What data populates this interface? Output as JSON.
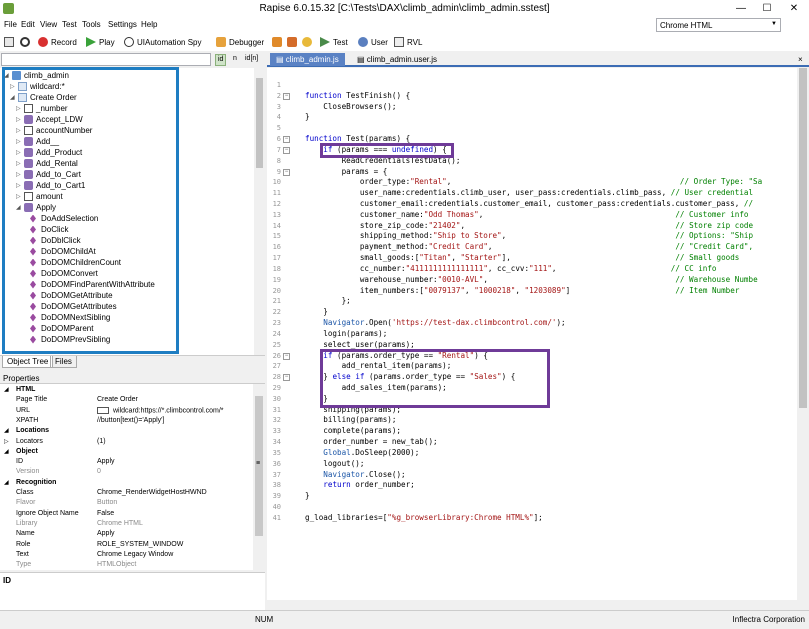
{
  "title": "Rapise 6.0.15.32 [C:\\Tests\\DAX\\climb_admin\\climb_admin.sstest]",
  "window_controls": [
    "—",
    "☐",
    "✕"
  ],
  "menu": [
    "File",
    "Edit",
    "View",
    "Test",
    "Tools",
    "Settings",
    "Help"
  ],
  "browser_select": "Chrome HTML",
  "toolbar": {
    "record": "Record",
    "play": "Play",
    "spy": "UIAutomation Spy",
    "debugger": "Debugger",
    "test": "Test",
    "user": "User",
    "rvl": "RVL"
  },
  "search": {
    "id_label": "id",
    "n_label": "n",
    "idn_label": "id[n]"
  },
  "tree": {
    "root": "climb_admin",
    "wildcard": "wildcard:*",
    "create_order": "Create Order",
    "objects": [
      "_number",
      "Accept_LDW",
      "accountNumber",
      "Add__",
      "Add_Product",
      "Add_Rental",
      "Add_to_Cart",
      "Add_to_Cart1",
      "amount"
    ],
    "apply": "Apply",
    "actions": [
      "DoAddSelection",
      "DoClick",
      "DoDblClick",
      "DoDOMChildAt",
      "DoDOMChildrenCount",
      "DoDOMConvert",
      "DoDOMFindParentWithAttribute",
      "DoDOMGetAttribute",
      "DoDOMGetAttributes",
      "DoDOMNextSibling",
      "DoDOMParent",
      "DoDOMPrevSibling"
    ]
  },
  "left_tabs": [
    "Object Tree",
    "Files"
  ],
  "properties": {
    "header": "Properties",
    "rows": [
      {
        "k": "HTML",
        "v": "",
        "sec": true,
        "exp": "◢"
      },
      {
        "k": "Page Title",
        "v": "Create Order"
      },
      {
        "k": "URL",
        "v": "wildcard:https://*.climbcontrol.com/*"
      },
      {
        "k": "XPATH",
        "v": "//button[text()='Apply']"
      },
      {
        "k": "Locations",
        "v": "",
        "sec": true,
        "exp": "◢"
      },
      {
        "k": "Locators",
        "v": "(1)",
        "exp": "▷"
      },
      {
        "k": "Object",
        "v": "",
        "sec": true,
        "exp": "◢"
      },
      {
        "k": "ID",
        "v": "Apply"
      },
      {
        "k": "Version",
        "v": "0",
        "gray": true
      },
      {
        "k": "Recognition",
        "v": "",
        "sec": true,
        "exp": "◢"
      },
      {
        "k": "Class",
        "v": "Chrome_RenderWidgetHostHWND"
      },
      {
        "k": "Flavor",
        "v": "Button",
        "gray": true
      },
      {
        "k": "Ignore Object Name",
        "v": "False"
      },
      {
        "k": "Library",
        "v": "Chrome HTML",
        "gray": true
      },
      {
        "k": "Name",
        "v": "Apply"
      },
      {
        "k": "Role",
        "v": "ROLE_SYSTEM_WINDOW"
      },
      {
        "k": "Text",
        "v": "Chrome Legacy Window"
      },
      {
        "k": "Type",
        "v": "HTMLObject",
        "gray": true
      }
    ]
  },
  "description": "ID",
  "editor_tabs": [
    "climb_admin.js",
    "climb_admin.user.js"
  ],
  "code": [
    {
      "n": "1",
      "t": ""
    },
    {
      "n": "2",
      "t": "function TestFinish() {",
      "fold": "−"
    },
    {
      "n": "3",
      "t": "    CloseBrowsers();"
    },
    {
      "n": "4",
      "t": "}"
    },
    {
      "n": "5",
      "t": ""
    },
    {
      "n": "6",
      "t": "function Test(params) {",
      "fold": "−"
    },
    {
      "n": "7",
      "t": "    if (params === undefined) {",
      "fold": "−"
    },
    {
      "n": "8",
      "t": "        ReadCredentialsTestData();"
    },
    {
      "n": "9",
      "t": "        params = {",
      "fold": "−"
    },
    {
      "n": "10",
      "t": "            order_type:\"Rental\",                                                  // Order Type: \"Sa"
    },
    {
      "n": "11",
      "t": "            user_name:credentials.climb_user, user_pass:credentials.climb_pass, // User credential"
    },
    {
      "n": "12",
      "t": "            customer_email:credentials.customer_email, customer_pass:credentials.customer_pass, //"
    },
    {
      "n": "13",
      "t": "            customer_name:\"Odd Thomas\",                                          // Customer info"
    },
    {
      "n": "14",
      "t": "            store_zip_code:\"21402\",                                              // Store zip code"
    },
    {
      "n": "15",
      "t": "            shipping_method:\"Ship to Store\",                                     // Options: \"Ship"
    },
    {
      "n": "16",
      "t": "            payment_method:\"Credit Card\",                                        // \"Credit Card\","
    },
    {
      "n": "17",
      "t": "            small_goods:[\"Titan\", \"Starter\"],                                    // Small goods"
    },
    {
      "n": "18",
      "t": "            cc_number:\"4111111111111111\", cc_cvv:\"111\",                         // CC info"
    },
    {
      "n": "19",
      "t": "            warehouse_number:\"0010-AVL\",                                         // Warehouse Numbe"
    },
    {
      "n": "20",
      "t": "            item_numbers:[\"0079137\", \"1000218\", \"1203089\"]                       // Item Number"
    },
    {
      "n": "21",
      "t": "        };"
    },
    {
      "n": "22",
      "t": "    }"
    },
    {
      "n": "23",
      "t": "    Navigator.Open('https://test-dax.climbcontrol.com/');"
    },
    {
      "n": "24",
      "t": "    login(params);"
    },
    {
      "n": "25",
      "t": "    select_user(params);"
    },
    {
      "n": "26",
      "t": "    if (params.order_type == \"Rental\") {",
      "fold": "−"
    },
    {
      "n": "27",
      "t": "        add_rental_item(params);"
    },
    {
      "n": "28",
      "t": "    } else if (params.order_type == \"Sales\") {",
      "fold": "−"
    },
    {
      "n": "29",
      "t": "        add_sales_item(params);"
    },
    {
      "n": "30",
      "t": "    }"
    },
    {
      "n": "31",
      "t": "    shipping(params);"
    },
    {
      "n": "32",
      "t": "    billing(params);"
    },
    {
      "n": "33",
      "t": "    complete(params);"
    },
    {
      "n": "34",
      "t": "    order_number = new_tab();"
    },
    {
      "n": "35",
      "t": "    Global.DoSleep(2000);"
    },
    {
      "n": "36",
      "t": "    logout();"
    },
    {
      "n": "37",
      "t": "    Navigator.Close();"
    },
    {
      "n": "38",
      "t": "    return order_number;"
    },
    {
      "n": "39",
      "t": "}"
    },
    {
      "n": "40",
      "t": ""
    },
    {
      "n": "41",
      "t": "g_load_libraries=[\"%g_browserLibrary:Chrome HTML%\"];"
    }
  ],
  "status": {
    "num": "NUM",
    "company": "Inflectra Corporation"
  }
}
